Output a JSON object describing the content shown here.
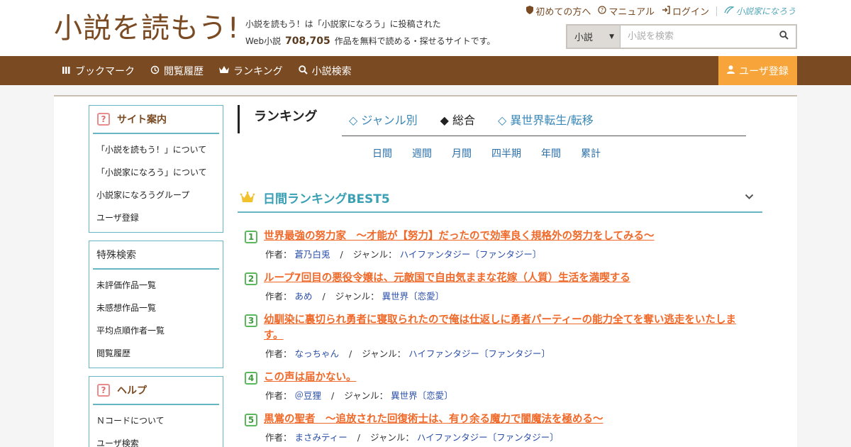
{
  "site": {
    "logo": "小説を読もう!",
    "tagline_1": "小説を読もう！は「小説家になろう」に投稿された",
    "tagline_2_prefix": "Web小説",
    "work_count": "708,705",
    "tagline_2_suffix": "作品を無料で読める・探せるサイトです。"
  },
  "toplinks": {
    "first_time": "初めての方へ",
    "manual": "マニュアル",
    "login": "ログイン",
    "partner_logo": "小説家になろう"
  },
  "search": {
    "scope": "小説",
    "placeholder": "小説を検索"
  },
  "nav": {
    "items": [
      {
        "label": "ブックマーク",
        "icon": "bookmark-icon"
      },
      {
        "label": "閲覧履歴",
        "icon": "history-icon"
      },
      {
        "label": "ランキング",
        "icon": "crown-icon"
      },
      {
        "label": "小説検索",
        "icon": "search-icon"
      }
    ],
    "register": "ユーザ登録"
  },
  "sidebar": {
    "guide": {
      "title": "サイト案内",
      "items": [
        "「小説を読もう！」について",
        "「小説家になろう」について",
        "小説家になろうグループ",
        "ユーザ登録"
      ]
    },
    "special": {
      "title": "特殊検索",
      "items": [
        "未評価作品一覧",
        "未感想作品一覧",
        "平均点順作者一覧",
        "閲覧履歴"
      ]
    },
    "help": {
      "title": "ヘルプ",
      "items": [
        "Ｎコードについて",
        "ユーザ検索"
      ]
    }
  },
  "ranking": {
    "title": "ランキング",
    "tabs": [
      {
        "label": "◇ ジャンル別"
      },
      {
        "label": "◆ 総合"
      },
      {
        "label": "◇ 異世界転生/転移"
      }
    ],
    "periods": [
      "日間",
      "週間",
      "月間",
      "四半期",
      "年間",
      "累計"
    ],
    "best_title": "日間ランキングBEST5",
    "author_label": "作者：",
    "genre_label": "ジャンル：",
    "items": [
      {
        "num": "1",
        "title": "世界最強の努力家　〜才能が【努力】だったので効率良く規格外の努力をしてみる〜",
        "author": "蒼乃白兎",
        "genre": "ハイファンタジー〔ファンタジー〕"
      },
      {
        "num": "2",
        "title": "ループ7回目の悪役令嬢は、元敵国で自由気ままな花嫁（人質）生活を満喫する",
        "author": "あめ",
        "genre": "異世界〔恋愛〕"
      },
      {
        "num": "3",
        "title": "幼馴染に裏切られ勇者に寝取られたので俺は仕返しに勇者パーティーの能力全てを奪い逃走をいたします。",
        "author": "なっちゃん",
        "genre": "ハイファンタジー〔ファンタジー〕"
      },
      {
        "num": "4",
        "title": "この声は届かない。",
        "author": "＠豆狸",
        "genre": "異世界〔恋愛〕"
      },
      {
        "num": "5",
        "title": "黒鴬の聖者　〜追放された回復術士は、有り余る魔力で闇魔法を極める〜",
        "author": "まさみティー",
        "genre": "ハイファンタジー〔ファンタジー〕"
      }
    ]
  },
  "colors": {
    "brown": "#7a4a22",
    "orange": "#f7a53a",
    "teal": "#66b6c4",
    "title_orange": "#ef6a2a",
    "link_blue": "#2a4fa8"
  }
}
